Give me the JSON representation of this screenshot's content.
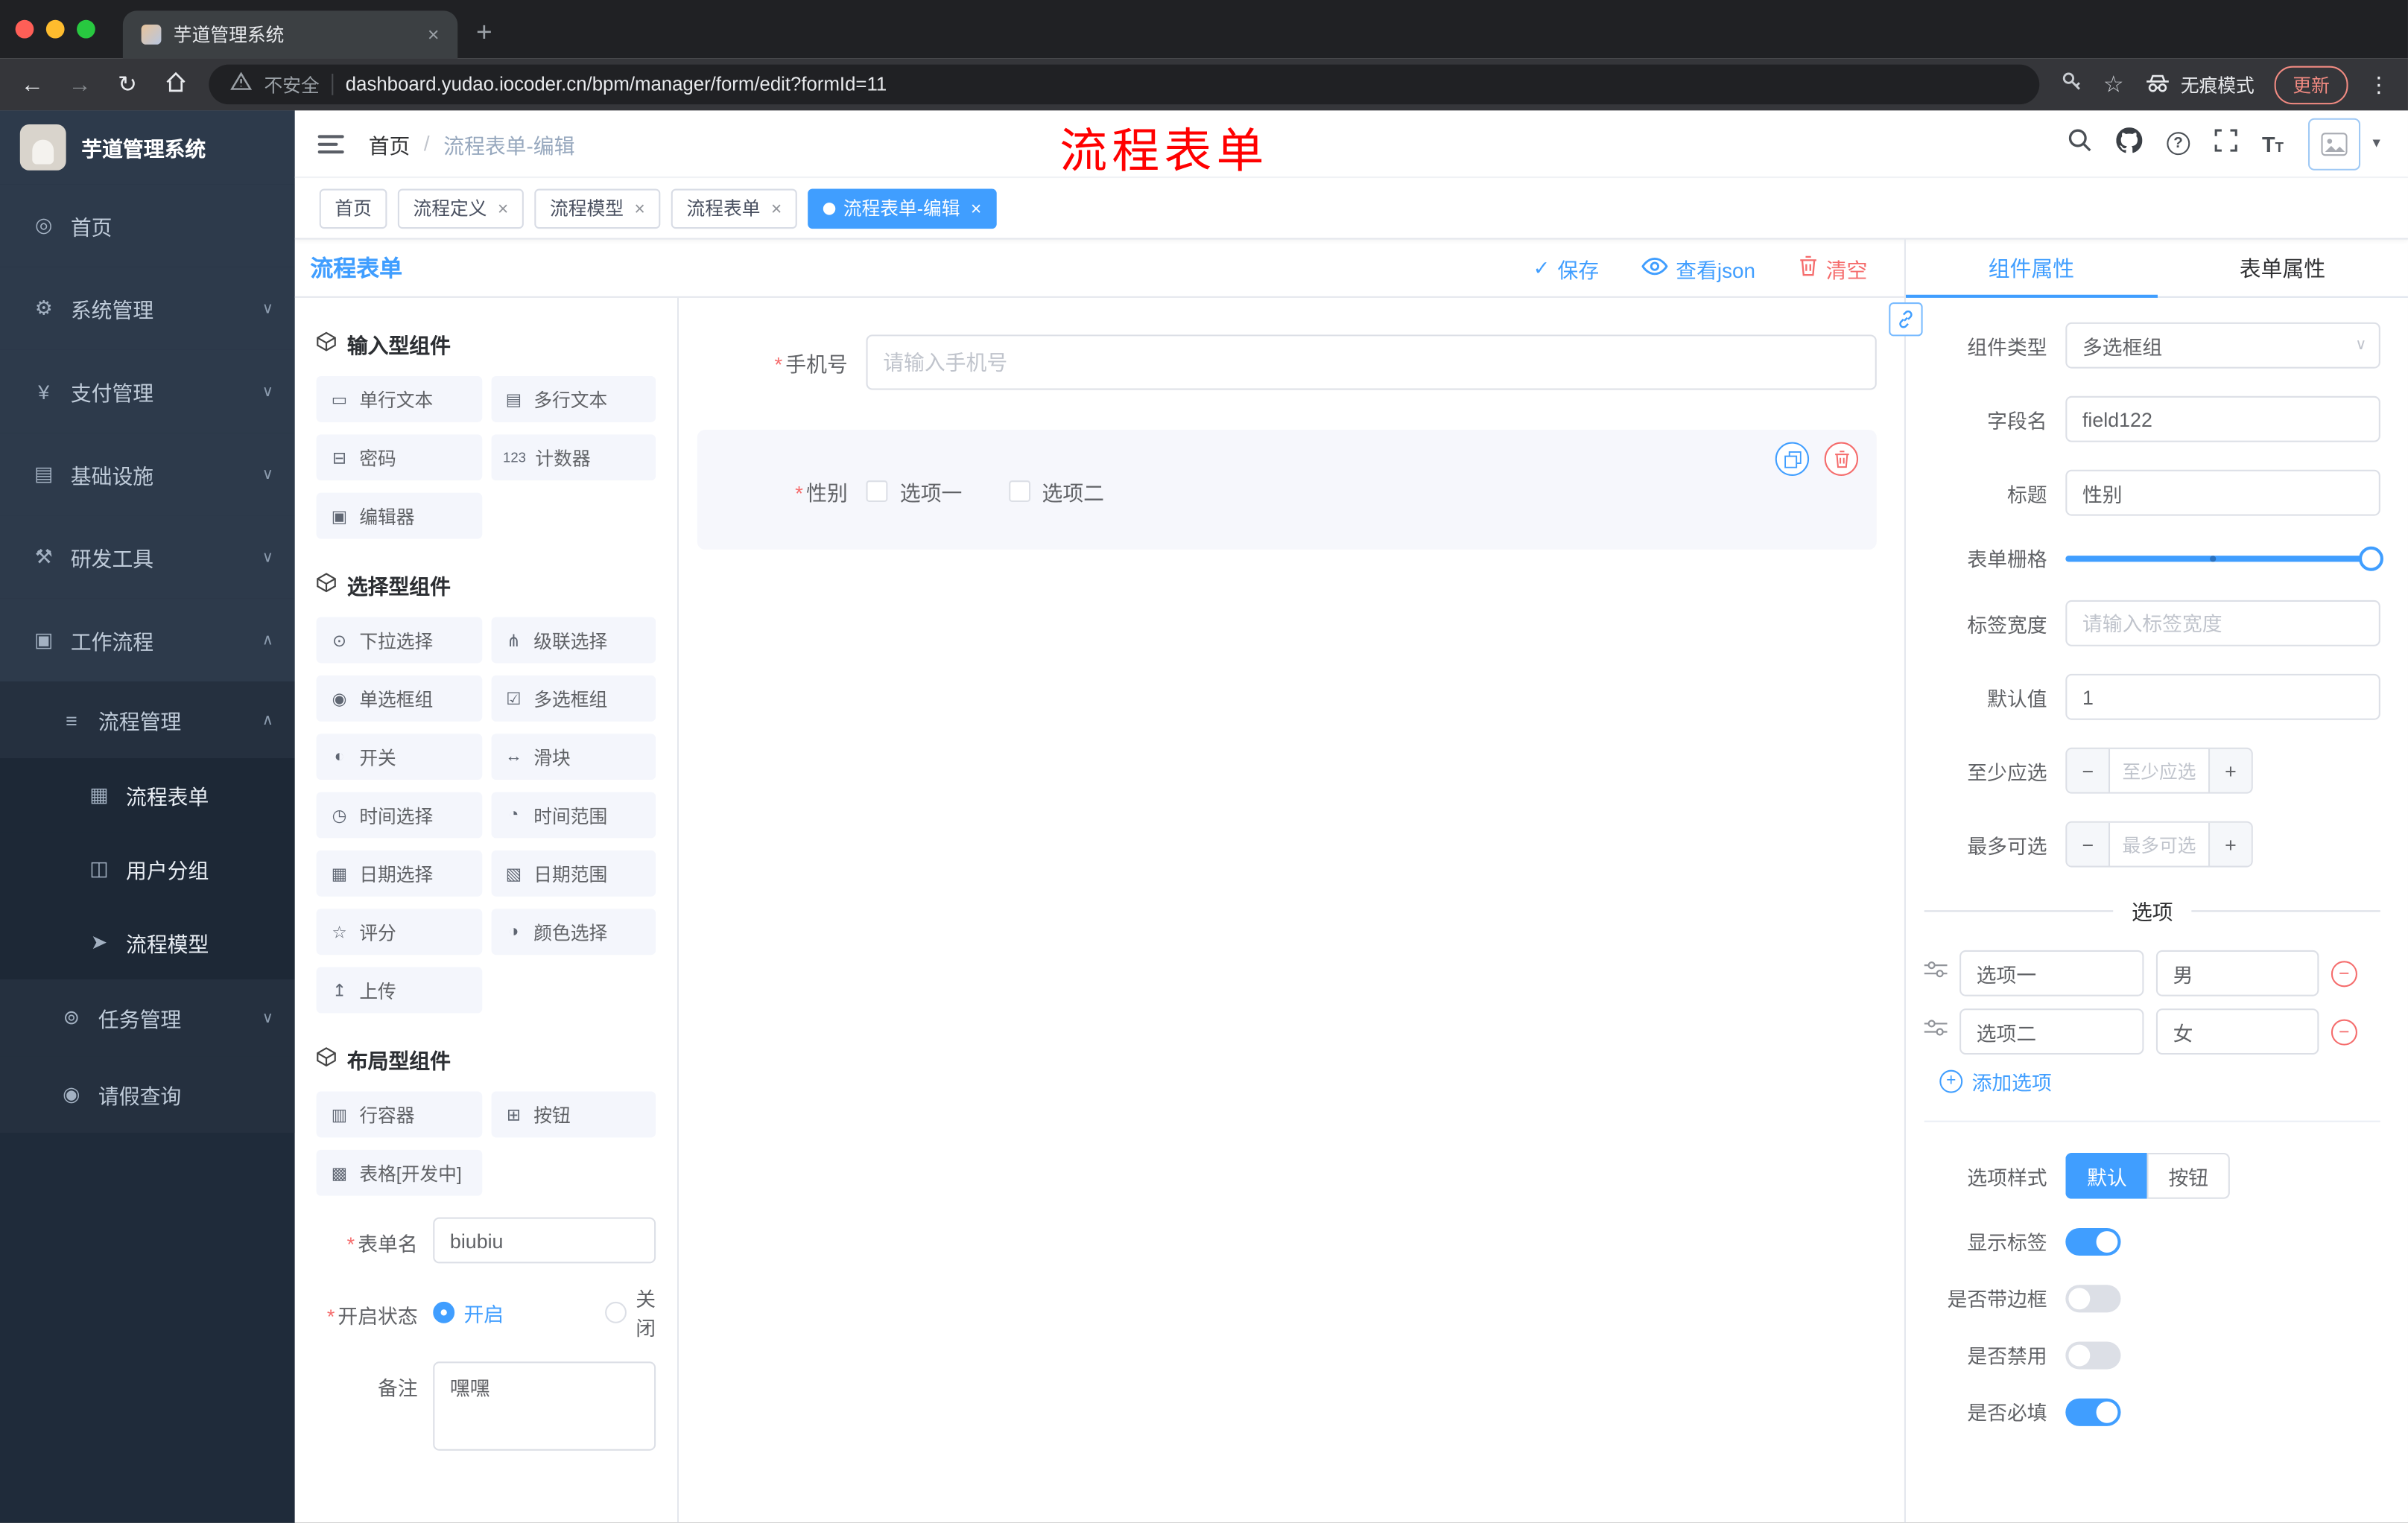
{
  "colors": {
    "primary": "#409eff",
    "danger": "#f56c6c",
    "annotation_red": "#ff0000"
  },
  "icons": {
    "chev_down": "∨",
    "chev_up": "∧",
    "close": "×",
    "plus": "+",
    "minus": "−",
    "check": "✓",
    "dots": "⋮",
    "caret_down": "▾",
    "back": "←",
    "forward": "→",
    "reload": "↻",
    "star": "☆",
    "required": "*",
    "select_caret": "∨"
  },
  "browser": {
    "tab_title": "芋道管理系统",
    "security_label": "不安全",
    "url": "dashboard.yudao.iocoder.cn/bpm/manager/form/edit?formId=11",
    "incognito_label": "无痕模式",
    "update_label": "更新"
  },
  "sidebar": {
    "logo_title": "芋道管理系统",
    "items": [
      {
        "label": "首页",
        "icon": "◎"
      },
      {
        "label": "系统管理",
        "icon": "⚙"
      },
      {
        "label": "支付管理",
        "icon": "¥"
      },
      {
        "label": "基础设施",
        "icon": "▤"
      },
      {
        "label": "研发工具",
        "icon": "⚒"
      },
      {
        "label": "工作流程",
        "icon": "▣"
      },
      {
        "label": "流程管理",
        "icon": "≡"
      },
      {
        "label": "流程表单",
        "icon": "▦"
      },
      {
        "label": "用户分组",
        "icon": "◫"
      },
      {
        "label": "流程模型",
        "icon": "➤"
      },
      {
        "label": "任务管理",
        "icon": "⊚"
      },
      {
        "label": "请假查询",
        "icon": "◉"
      }
    ]
  },
  "header": {
    "breadcrumb_home": "首页",
    "breadcrumb_current": "流程表单-编辑",
    "annotation": "流程表单"
  },
  "tagbar": {
    "tags": [
      {
        "label": "首页",
        "closable": false,
        "active": false
      },
      {
        "label": "流程定义",
        "closable": true,
        "active": false
      },
      {
        "label": "流程模型",
        "closable": true,
        "active": false
      },
      {
        "label": "流程表单",
        "closable": true,
        "active": false
      },
      {
        "label": "流程表单-编辑",
        "closable": true,
        "active": true
      }
    ]
  },
  "designer": {
    "title": "流程表单",
    "save_label": "保存",
    "view_json_label": "查看json",
    "clear_label": "清空",
    "palette_sections": [
      {
        "title": "输入型组件",
        "items": [
          {
            "label": "单行文本",
            "icon": "▭"
          },
          {
            "label": "多行文本",
            "icon": "▤"
          },
          {
            "label": "密码",
            "icon": "⊟"
          },
          {
            "label": "计数器",
            "icon": "123"
          },
          {
            "label": "编辑器",
            "icon": "▣"
          }
        ]
      },
      {
        "title": "选择型组件",
        "items": [
          {
            "label": "下拉选择",
            "icon": "⊙"
          },
          {
            "label": "级联选择",
            "icon": "⋔"
          },
          {
            "label": "单选框组",
            "icon": "◉"
          },
          {
            "label": "多选框组",
            "icon": "☑"
          },
          {
            "label": "开关",
            "icon": "◐"
          },
          {
            "label": "滑块",
            "icon": "↔"
          },
          {
            "label": "时间选择",
            "icon": "◷"
          },
          {
            "label": "时间范围",
            "icon": "◔"
          },
          {
            "label": "日期选择",
            "icon": "▦"
          },
          {
            "label": "日期范围",
            "icon": "▧"
          },
          {
            "label": "评分",
            "icon": "☆"
          },
          {
            "label": "颜色选择",
            "icon": "◑"
          },
          {
            "label": "上传",
            "icon": "↥"
          }
        ]
      },
      {
        "title": "布局型组件",
        "items": [
          {
            "label": "行容器",
            "icon": "▥"
          },
          {
            "label": "按钮",
            "icon": "⊞"
          },
          {
            "label": "表格[开发中]",
            "icon": "▩"
          }
        ]
      }
    ],
    "meta": {
      "form_name_label": "表单名",
      "form_name_value": "biubiu",
      "status_label": "开启状态",
      "status_on": "开启",
      "status_off": "关闭",
      "remark_label": "备注",
      "remark_value": "嘿嘿"
    },
    "canvas": {
      "phone_label": "手机号",
      "phone_placeholder": "请输入手机号",
      "gender_label": "性别",
      "gender_options": [
        "选项一",
        "选项二"
      ]
    }
  },
  "props": {
    "tab_component": "组件属性",
    "tab_form": "表单属性",
    "rows": {
      "type_label": "组件类型",
      "type_value": "多选框组",
      "field_label": "字段名",
      "field_value": "field122",
      "title_label": "标题",
      "title_value": "性别",
      "grid_label": "表单栅格",
      "width_label": "标签宽度",
      "width_placeholder": "请输入标签宽度",
      "default_label": "默认值",
      "default_value": "1",
      "min_label": "至少应选",
      "min_placeholder": "至少应选",
      "max_label": "最多可选",
      "max_placeholder": "最多可选"
    },
    "options_divider": "选项",
    "options": [
      {
        "label": "选项一",
        "value": "男"
      },
      {
        "label": "选项二",
        "value": "女"
      }
    ],
    "add_option_label": "添加选项",
    "style_label": "选项样式",
    "style_default": "默认",
    "style_button": "按钮",
    "switches": [
      {
        "label": "显示标签",
        "on": true
      },
      {
        "label": "是否带边框",
        "on": false
      },
      {
        "label": "是否禁用",
        "on": false
      },
      {
        "label": "是否必填",
        "on": true
      }
    ]
  }
}
